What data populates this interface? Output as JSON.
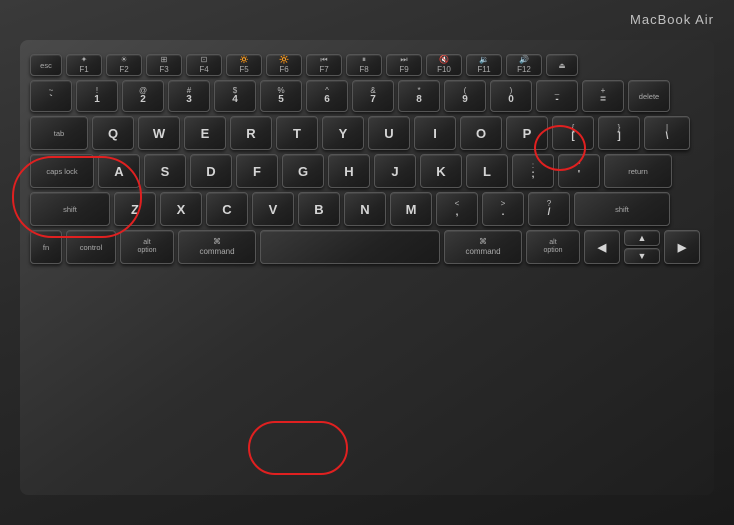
{
  "header": {
    "brand": "MacBook Air"
  },
  "keyboard": {
    "rows": {
      "fn_row": [
        "esc",
        "",
        "F1",
        "",
        "F2",
        "",
        "F3",
        "",
        "F4",
        "",
        "F5",
        "",
        "F6"
      ],
      "num_row": [
        "`~",
        "1!",
        "2@",
        "3#",
        "4$",
        "5%",
        "6^",
        "7&",
        "8*",
        "9(",
        "0)",
        "-_",
        "=+",
        "delete"
      ],
      "row_tab": [
        "tab",
        "Q",
        "W",
        "E",
        "R",
        "T",
        "Y",
        "U",
        "I",
        "O",
        "P",
        "[{",
        "]}",
        "\\|"
      ],
      "row_caps": [
        "caps lock",
        "A",
        "S",
        "D",
        "F",
        "G",
        "H",
        "J",
        "K",
        "L",
        ";:",
        "'\"",
        "return"
      ],
      "row_shift": [
        "shift",
        "Z",
        "X",
        "C",
        "V",
        "B",
        "N",
        "M",
        ",<",
        ".>",
        "/?",
        "shift"
      ],
      "row_bottom": [
        "fn",
        "control",
        "option",
        "command",
        "",
        "command",
        "option"
      ]
    }
  }
}
